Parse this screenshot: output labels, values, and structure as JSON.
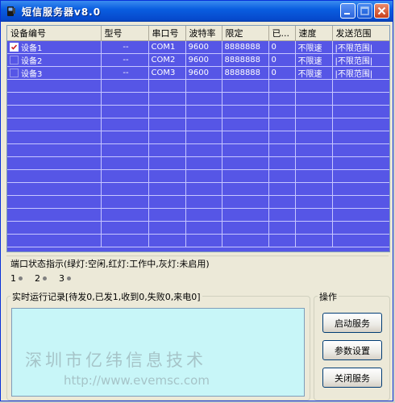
{
  "window": {
    "title": "短信服务器v8.0",
    "title_color": "#ffffff",
    "titlebar_color": "#0a5ee0"
  },
  "grid": {
    "columns": [
      "设备编号",
      "型号",
      "串口号",
      "波特率",
      "限定",
      "已...",
      "速度",
      "发送范围"
    ],
    "rows": [
      {
        "checked": true,
        "device": "设备1",
        "model": "--",
        "port": "COM1",
        "baud": "9600",
        "limit": "8888888",
        "sent": "0",
        "speed": "不限速",
        "range": "|不限范围|"
      },
      {
        "checked": false,
        "device": "设备2",
        "model": "--",
        "port": "COM2",
        "baud": "9600",
        "limit": "8888888",
        "sent": "0",
        "speed": "不限速",
        "range": "|不限范围|"
      },
      {
        "checked": false,
        "device": "设备3",
        "model": "--",
        "port": "COM3",
        "baud": "9600",
        "limit": "8888888",
        "sent": "0",
        "speed": "不限速",
        "range": "|不限范围|"
      }
    ],
    "background_color": "#5656e6"
  },
  "port_status": {
    "legend": "端口状态指示(绿灯:空闲,红灯:工作中,灰灯:未启用)",
    "ports": [
      "1",
      "2",
      "3"
    ]
  },
  "log": {
    "legend": "实时运行记录[待发0,已发1,收到0,失败0,来电0]",
    "watermark_company": "深圳市亿纬信息技术",
    "watermark_url": "http://www.evemsc.com"
  },
  "operations": {
    "legend": "操作",
    "start_label": "启动服务",
    "settings_label": "参数设置",
    "stop_label": "关闭服务"
  }
}
